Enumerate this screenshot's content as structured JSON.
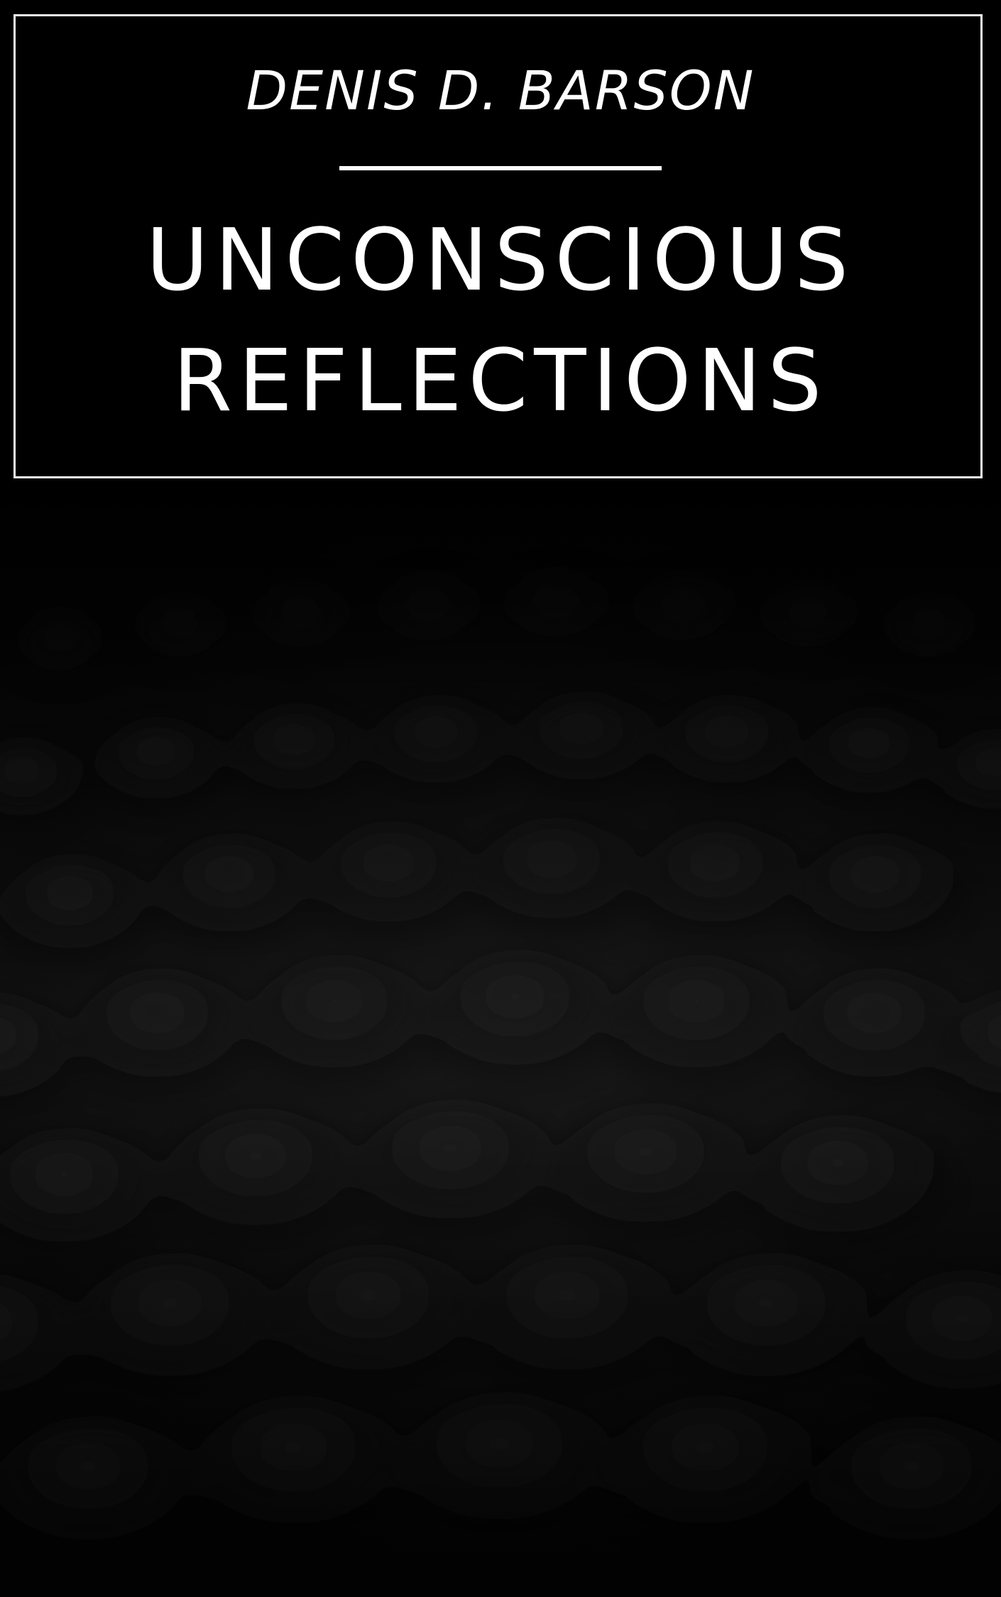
{
  "cover": {
    "author": "DENIS D. BARSON",
    "title_lines": [
      "UNCONSCIOUS",
      "REFLECTIONS"
    ]
  },
  "background_image": {
    "semantic": "dark acoustic foam texture"
  },
  "colors": {
    "background": "#000000",
    "text": "#ffffff",
    "frame": "#f2f2f2"
  }
}
